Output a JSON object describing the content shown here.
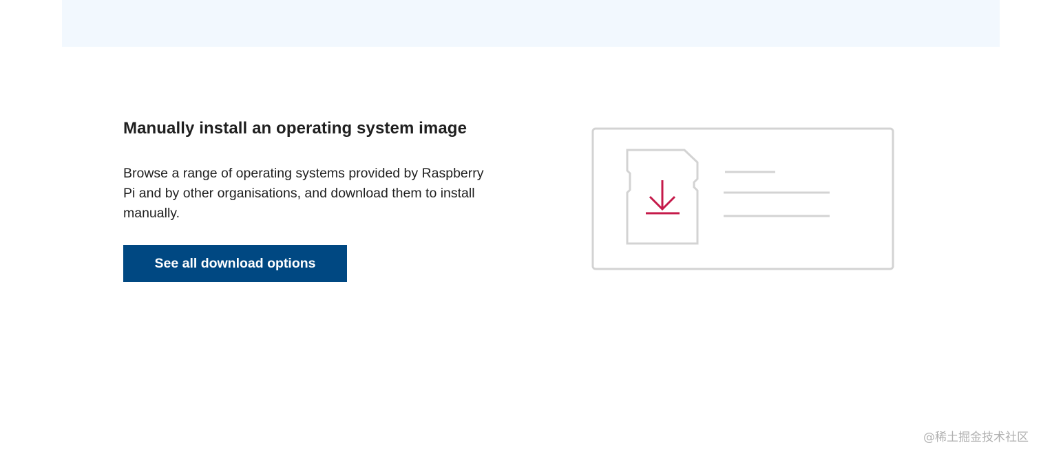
{
  "section": {
    "title": "Manually install an operating system image",
    "description": "Browse a range of operating systems provided by Raspberry Pi and by other organisations, and download them to install manually.",
    "button_label": "See all download options"
  },
  "illustration": {
    "icon": "sd-card-download-icon",
    "stroke_color": "#d3d3d3",
    "accent_color": "#c51a4a"
  },
  "watermark": "@稀土掘金技术社区",
  "colors": {
    "banner": "#f2f8fe",
    "button": "#004882",
    "text": "#1f1f1f"
  }
}
